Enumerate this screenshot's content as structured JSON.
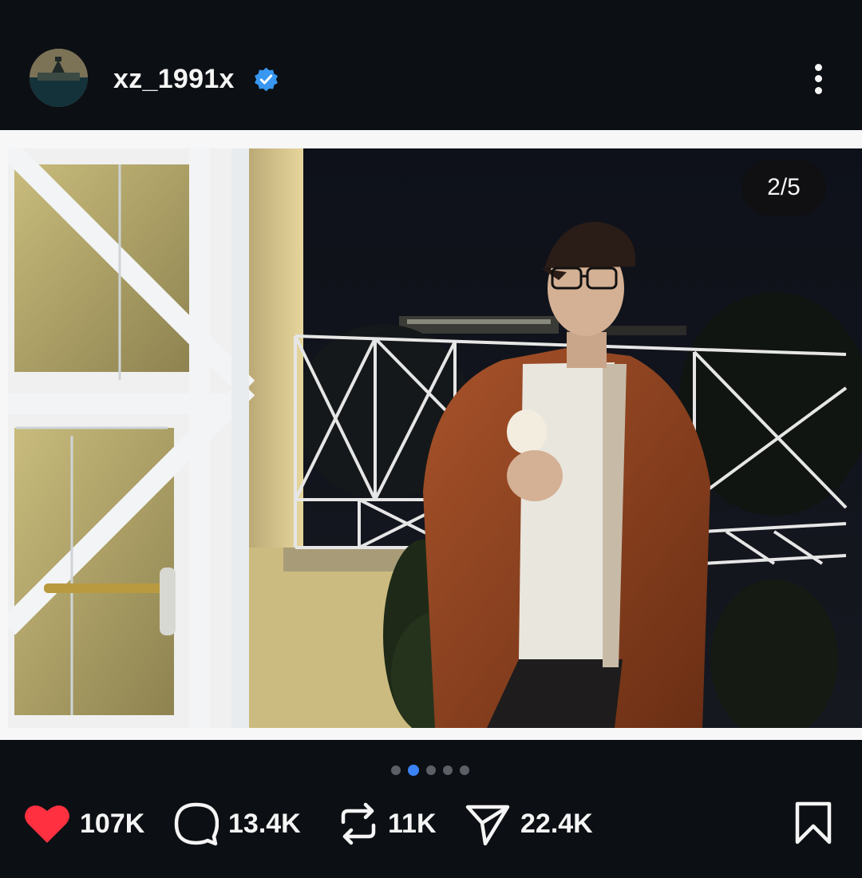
{
  "post": {
    "username": "xz_1991x",
    "verified": true,
    "slide_counter": "2/5",
    "current_slide": 2,
    "total_slides": 5
  },
  "actions": {
    "likes": "107K",
    "comments": "13.4K",
    "reposts": "11K",
    "shares": "22.4K"
  },
  "icons": {
    "verified": "verified-badge-icon",
    "more": "more-vertical-icon",
    "like": "heart-icon",
    "comment": "comment-icon",
    "repost": "repost-icon",
    "share": "send-icon",
    "save": "bookmark-icon"
  },
  "colors": {
    "background": "#0c1014",
    "accent": "#3b82f6",
    "like": "#ff3040",
    "verified": "#3897f0"
  }
}
